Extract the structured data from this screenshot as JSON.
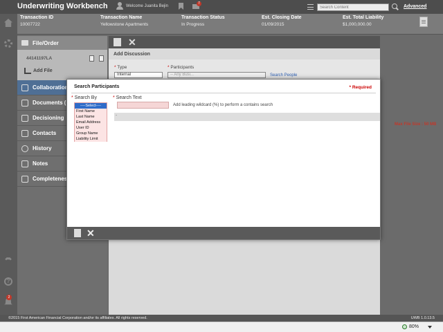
{
  "header": {
    "app_title": "Underwriting Workbench",
    "welcome": "Welcome Juanita Bejin",
    "mail_count": "7",
    "search_placeholder": "Search Content",
    "advanced_label": "Advanced"
  },
  "transaction": {
    "columns": [
      {
        "label": "Transaction ID",
        "value": "10007722"
      },
      {
        "label": "Transaction Name",
        "value": "Yellowstone Apartments"
      },
      {
        "label": "Transaction Status",
        "value": "In Progress"
      },
      {
        "label": "Est. Closing Date",
        "value": "01/09/2015"
      },
      {
        "label": "Est. Total Liability",
        "value": "$1,000,000.00"
      }
    ]
  },
  "rail": {
    "notification_count": "2"
  },
  "nav": {
    "header": "File/Order",
    "file_number": "44141197LA",
    "add_file": "Add File",
    "items": [
      {
        "label": "Collaboration",
        "active": true
      },
      {
        "label": "Documents (",
        "active": false
      },
      {
        "label": "Decisioning",
        "active": false
      },
      {
        "label": "Contacts",
        "active": false
      },
      {
        "label": "History",
        "active": false
      },
      {
        "label": "Notes",
        "active": false
      },
      {
        "label": "Completeness",
        "active": false
      }
    ]
  },
  "main": {
    "title": "Add Discussion",
    "type_label": "Type",
    "type_value": "Internal",
    "participants_label": "Participants",
    "participants_value": "-- Any Busi...",
    "search_people": "Search People",
    "max_file_size": "Max File Size : 50 MB"
  },
  "modal": {
    "title": "Search Participants",
    "required": "* Required",
    "search_by_label": "Search By",
    "search_text_label": "Search Text",
    "search_text_value": "",
    "hint": "Add leading wildcard (%) to perform a contains search",
    "results_marker": "-",
    "options": [
      "----Select----",
      "First Name",
      "Last Name",
      "Email Address",
      "User ID",
      "Group Name",
      "Liability Limit"
    ],
    "selected_option": "----Select----"
  },
  "footer": {
    "copyright": "©2015 First American Financial Corporation and/or its affiliates. All rights reserved.",
    "version": "UWB 1.0.13.5"
  },
  "statusbar": {
    "zoom": "80%"
  }
}
